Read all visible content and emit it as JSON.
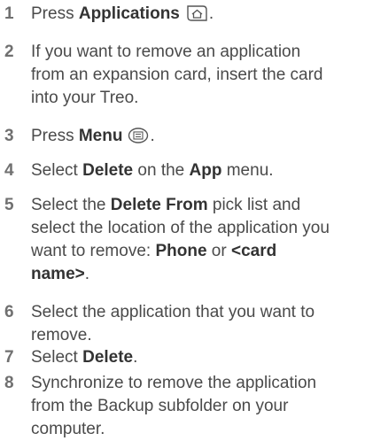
{
  "steps": [
    {
      "number": "1",
      "lines": [
        [
          {
            "t": "Press ",
            "b": false
          },
          {
            "t": "Applications",
            "b": true
          },
          {
            "icon": "applications-button-icon"
          },
          {
            "t": ".",
            "b": false
          }
        ]
      ]
    },
    {
      "number": "2",
      "lines": [
        [
          {
            "t": "If you want to remove an application",
            "b": false
          }
        ],
        [
          {
            "t": "from an expansion card, insert the card",
            "b": false
          }
        ],
        [
          {
            "t": "into your Treo.",
            "b": false
          }
        ]
      ]
    },
    {
      "number": "3",
      "lines": [
        [
          {
            "t": "Press ",
            "b": false
          },
          {
            "t": "Menu",
            "b": true
          },
          {
            "icon": "menu-button-icon"
          },
          {
            "t": ".",
            "b": false
          }
        ]
      ]
    },
    {
      "number": "4",
      "lines": [
        [
          {
            "t": "Select ",
            "b": false
          },
          {
            "t": "Delete",
            "b": true
          },
          {
            "t": " on the ",
            "b": false
          },
          {
            "t": "App",
            "b": true
          },
          {
            "t": " menu.",
            "b": false
          }
        ]
      ]
    },
    {
      "number": "5",
      "lines": [
        [
          {
            "t": "Select the ",
            "b": false
          },
          {
            "t": "Delete From",
            "b": true
          },
          {
            "t": " pick list and",
            "b": false
          }
        ],
        [
          {
            "t": "select the location of the application you",
            "b": false
          }
        ],
        [
          {
            "t": "want to remove: ",
            "b": false
          },
          {
            "t": "Phone",
            "b": true
          },
          {
            "t": " or ",
            "b": false
          },
          {
            "t": "<card",
            "b": true
          }
        ],
        [
          {
            "t": "name>",
            "b": true
          },
          {
            "t": ".",
            "b": false
          }
        ]
      ]
    },
    {
      "number": "6",
      "lines": [
        [
          {
            "t": "Select the application that you want to",
            "b": false
          }
        ],
        [
          {
            "t": "remove.",
            "b": false
          }
        ]
      ]
    },
    {
      "number": "7",
      "lines": [
        [
          {
            "t": "Select ",
            "b": false
          },
          {
            "t": "Delete",
            "b": true
          },
          {
            "t": ".",
            "b": false
          }
        ]
      ]
    },
    {
      "number": "8",
      "lines": [
        [
          {
            "t": "Synchronize to remove the application",
            "b": false
          }
        ],
        [
          {
            "t": "from the Backup subfolder on your",
            "b": false
          }
        ],
        [
          {
            "t": "computer.",
            "b": false
          }
        ]
      ]
    }
  ]
}
